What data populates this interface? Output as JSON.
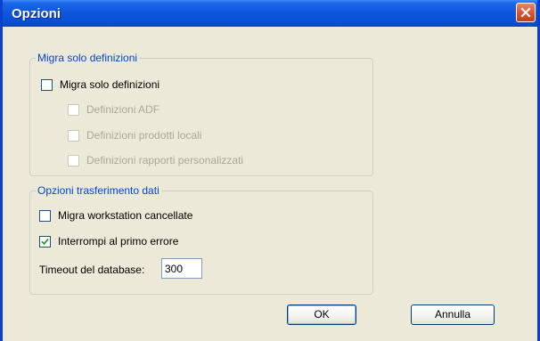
{
  "dialog": {
    "title": "Opzioni"
  },
  "group_definitions": {
    "title": "Migra solo definizioni",
    "main_option": {
      "label": "Migra solo definizioni",
      "checked": false
    },
    "sub_options": [
      {
        "label": "Definizioni ADF",
        "checked": false,
        "disabled": true
      },
      {
        "label": "Definizioni prodotti locali",
        "checked": false,
        "disabled": true
      },
      {
        "label": "Definizioni rapporti personalizzati",
        "checked": false,
        "disabled": true
      }
    ]
  },
  "group_transfer": {
    "title": "Opzioni trasferimento dati",
    "options": [
      {
        "label": "Migra workstation cancellate",
        "checked": false
      },
      {
        "label": "Interrompi al primo errore",
        "checked": true
      }
    ],
    "timeout_label": "Timeout del database:",
    "timeout_value": "300"
  },
  "buttons": {
    "ok": "OK",
    "cancel": "Annulla"
  },
  "colors": {
    "titlebar": "#0a4fd4",
    "group_title": "#0046d5",
    "check_mark": "#21a121",
    "close_button": "#d8522e"
  }
}
